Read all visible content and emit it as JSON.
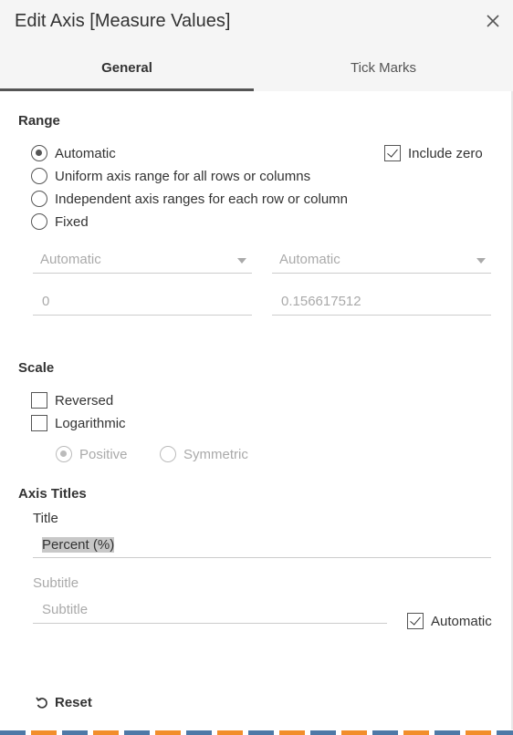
{
  "dialog": {
    "title": "Edit Axis [Measure Values]"
  },
  "tabs": [
    {
      "label": "General",
      "active": true
    },
    {
      "label": "Tick Marks",
      "active": false
    }
  ],
  "range": {
    "heading": "Range",
    "options": [
      {
        "label": "Automatic",
        "selected": true
      },
      {
        "label": "Uniform axis range for all rows or columns",
        "selected": false
      },
      {
        "label": "Independent axis ranges for each row or column",
        "selected": false
      },
      {
        "label": "Fixed",
        "selected": false
      }
    ],
    "include_zero": {
      "label": "Include zero",
      "checked": true
    },
    "start_dropdown": "Automatic",
    "end_dropdown": "Automatic",
    "start_value": "0",
    "end_value": "0.156617512"
  },
  "scale": {
    "heading": "Scale",
    "reversed": {
      "label": "Reversed",
      "checked": false
    },
    "logarithmic": {
      "label": "Logarithmic",
      "checked": false
    },
    "positive": {
      "label": "Positive",
      "selected": true
    },
    "symmetric": {
      "label": "Symmetric",
      "selected": false
    }
  },
  "axis_titles": {
    "heading": "Axis Titles",
    "title_label": "Title",
    "title_value": "Percent (%)",
    "subtitle_label": "Subtitle",
    "subtitle_placeholder": "Subtitle",
    "automatic": {
      "label": "Automatic",
      "checked": true
    }
  },
  "footer": {
    "reset_label": "Reset"
  },
  "colors": {
    "accent_blue": "#4e79a7",
    "accent_orange": "#f28e2b",
    "tab_underline": "#555555"
  }
}
